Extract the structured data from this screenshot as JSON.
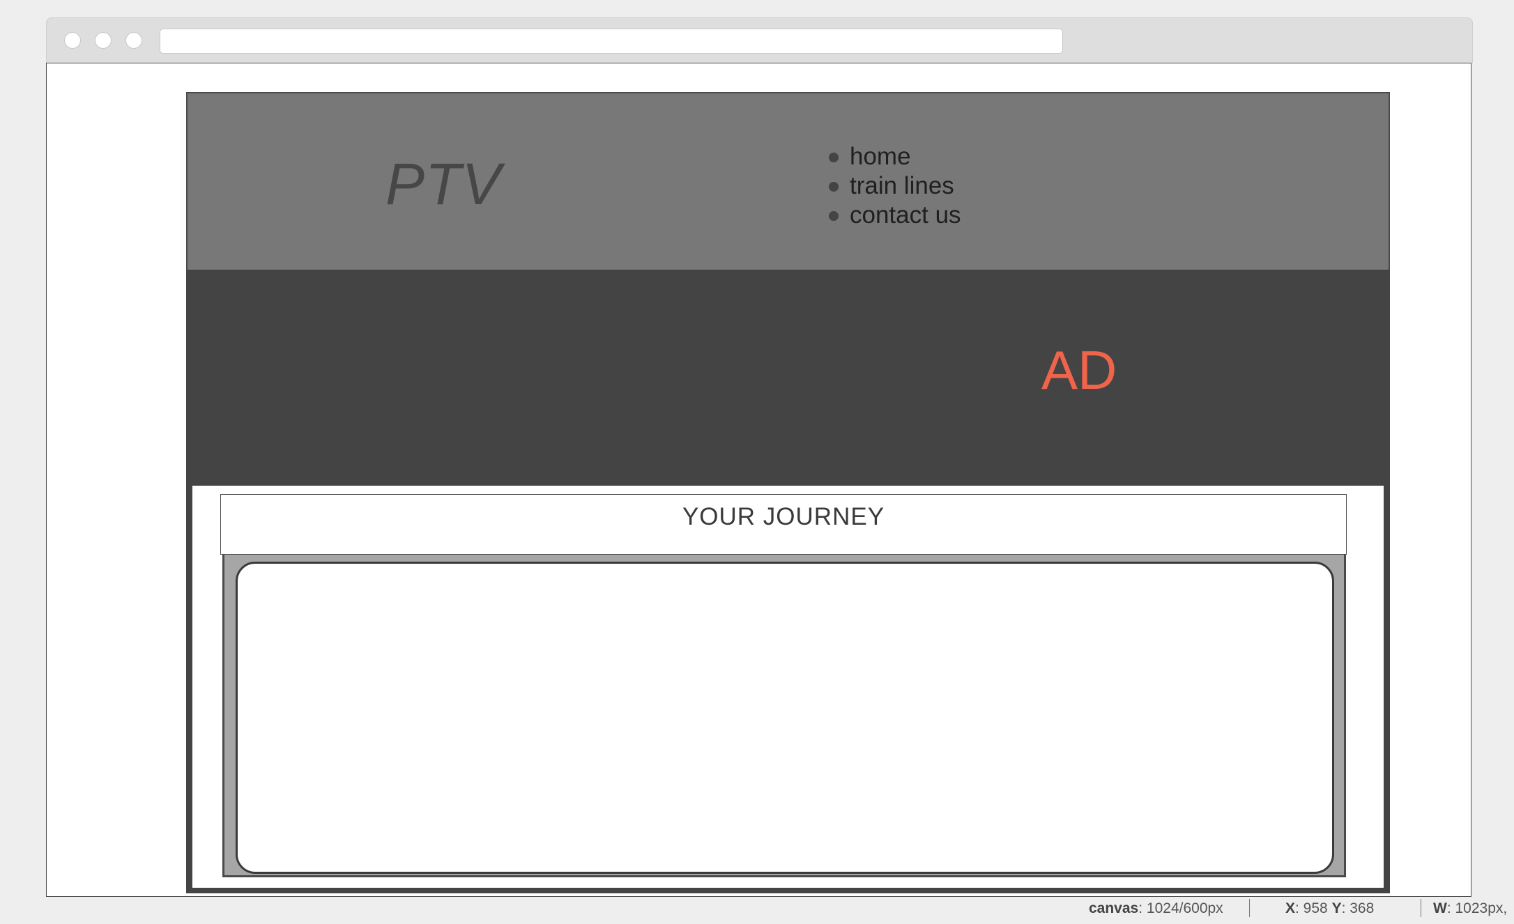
{
  "site": {
    "logo": "PTV",
    "nav": [
      "home",
      "train lines",
      "contact us"
    ],
    "ad_text": "AD",
    "journey_title": "YOUR JOURNEY"
  },
  "statusbar": {
    "canvas_label": "canvas",
    "canvas_value": ": 1024/600px",
    "x_label": "X",
    "x_value": ": 958 ",
    "y_label": "Y",
    "y_value": ": 368",
    "w_label": "W",
    "w_value": ": 1023px,"
  },
  "colors": {
    "header_bg": "#787878",
    "banner_bg": "#444444",
    "ad_accent": "#f0644a",
    "panel_bg": "#a6a6a6"
  }
}
